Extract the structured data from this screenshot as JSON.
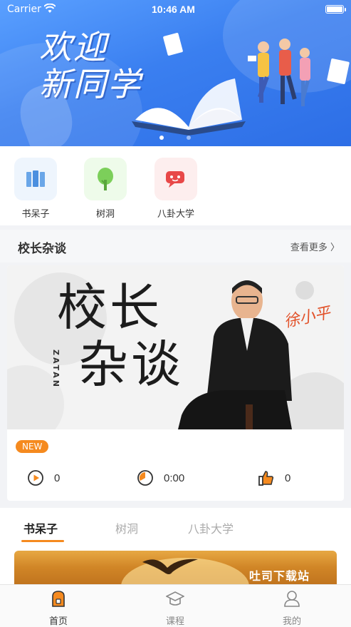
{
  "status_bar": {
    "carrier": "Carrier",
    "time": "10:46 AM"
  },
  "hero": {
    "title_line1": "欢迎",
    "title_line2": "新同学",
    "slides": 2,
    "active_slide": 0
  },
  "quick_entries": [
    {
      "label": "书呆子",
      "icon": "book-icon",
      "bg": "#eef5fd"
    },
    {
      "label": "树洞",
      "icon": "tree-icon",
      "bg": "#eefbea"
    },
    {
      "label": "八卦大学",
      "icon": "chat-icon",
      "bg": "#fdeeee"
    }
  ],
  "section": {
    "title": "校长杂谈",
    "more": "查看更多 〉"
  },
  "feature": {
    "cover_line1": "校长",
    "cover_line2": "杂谈",
    "cover_latin": "ZATAN",
    "badge": "NEW",
    "plays": "0",
    "duration": "0:00",
    "likes": "0"
  },
  "tabs": {
    "items": [
      "书呆子",
      "树洞",
      "八卦大学"
    ],
    "active": 0,
    "watermark": "吐司下载站"
  },
  "bottom_nav": [
    {
      "label": "首页",
      "icon": "home-icon",
      "active": true
    },
    {
      "label": "课程",
      "icon": "graduation-cap-icon",
      "active": false
    },
    {
      "label": "我的",
      "icon": "user-icon",
      "active": false
    }
  ],
  "colors": {
    "accent": "#f58a1f",
    "hero_blue": "#3a7ff0"
  }
}
